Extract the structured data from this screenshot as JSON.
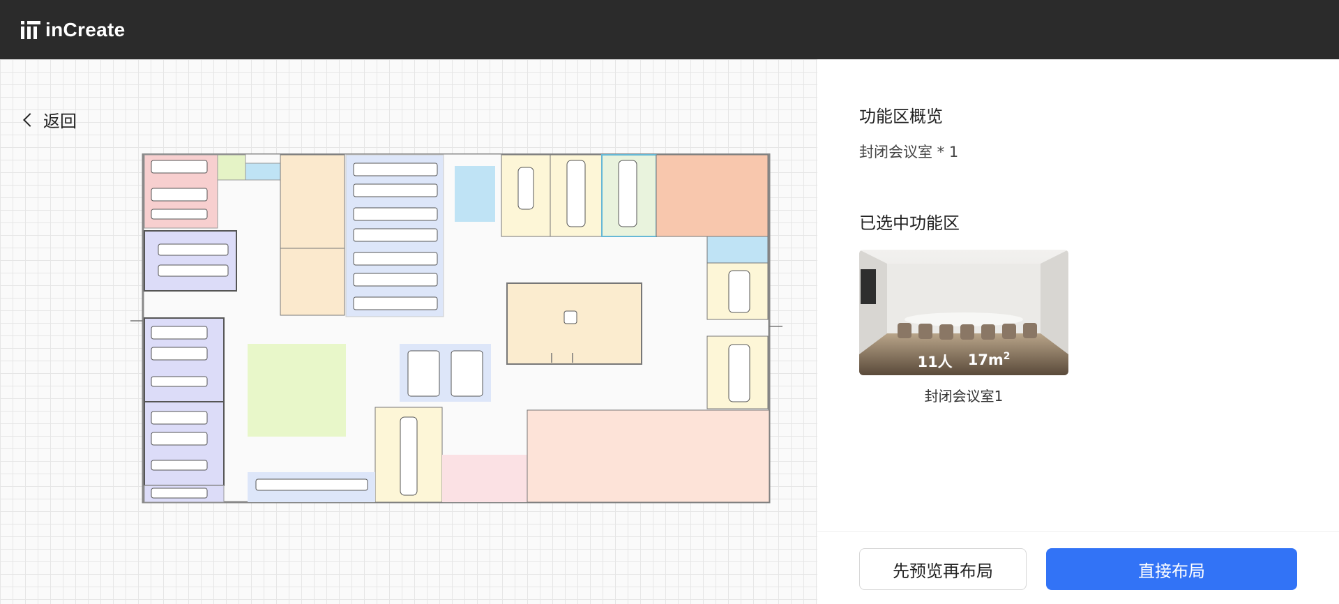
{
  "header": {
    "logo_text": "inCreate"
  },
  "nav": {
    "back_label": "返回"
  },
  "panel": {
    "overview_title": "功能区概览",
    "overview_item": "封闭会议室 * 1",
    "selected_title": "已选中功能区",
    "card": {
      "people": "11人",
      "area_value": "17m",
      "area_sup": "2",
      "caption": "封闭会议室1"
    }
  },
  "actions": {
    "preview_label": "先预览再布局",
    "apply_label": "直接布局"
  },
  "colors": {
    "accent": "#3273f6",
    "topbar": "#2b2b2b"
  }
}
